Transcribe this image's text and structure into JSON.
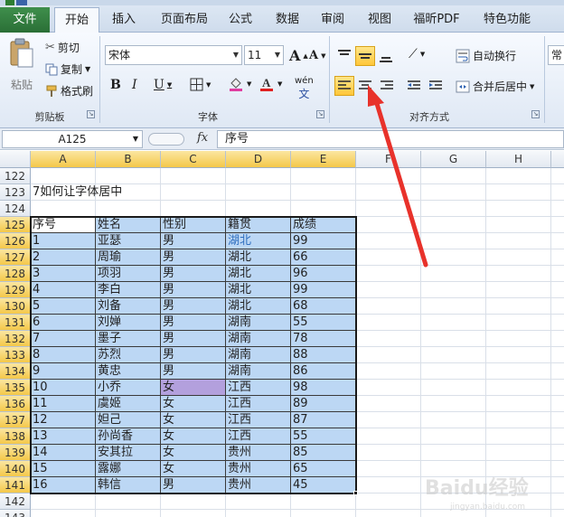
{
  "ribbon_tabs": [
    "文件",
    "开始",
    "插入",
    "页面布局",
    "公式",
    "数据",
    "审阅",
    "视图",
    "福昕PDF",
    "特色功能"
  ],
  "active_tab": "开始",
  "clipboard": {
    "paste": "粘贴",
    "cut": "剪切",
    "copy": "复制",
    "format_painter": "格式刷",
    "group_label": "剪贴板"
  },
  "font": {
    "name": "宋体",
    "size": "11",
    "group_label": "字体",
    "bold": "B",
    "italic": "I",
    "underline": "U",
    "grow": "A",
    "shrink": "A",
    "phonetic": "wén"
  },
  "alignment": {
    "wrap_text": "自动换行",
    "merge_center": "合并后居中",
    "group_label": "对齐方式"
  },
  "number": {
    "format": "常"
  },
  "formula_bar": {
    "name_box": "A125",
    "fx": "fx",
    "content": "序号"
  },
  "columns": [
    "A",
    "B",
    "C",
    "D",
    "E",
    "F",
    "G",
    "H"
  ],
  "rows": [
    {
      "num": "122",
      "cells": [
        "",
        "",
        "",
        "",
        ""
      ]
    },
    {
      "num": "123",
      "cells": [
        "7如何让字体居中",
        "",
        "",
        "",
        ""
      ]
    },
    {
      "num": "124",
      "cells": [
        "",
        "",
        "",
        "",
        ""
      ]
    },
    {
      "num": "125",
      "cells": [
        "序号",
        "姓名",
        "性别",
        "籍贯",
        "成绩"
      ]
    },
    {
      "num": "126",
      "cells": [
        "1",
        "亚瑟",
        "男",
        "湖北",
        "99"
      ]
    },
    {
      "num": "127",
      "cells": [
        "2",
        "周瑜",
        "男",
        "湖北",
        "66"
      ]
    },
    {
      "num": "128",
      "cells": [
        "3",
        "项羽",
        "男",
        "湖北",
        "96"
      ]
    },
    {
      "num": "129",
      "cells": [
        "4",
        "李白",
        "男",
        "湖北",
        "99"
      ]
    },
    {
      "num": "130",
      "cells": [
        "5",
        "刘备",
        "男",
        "湖北",
        "68"
      ]
    },
    {
      "num": "131",
      "cells": [
        "6",
        "刘婵",
        "男",
        "湖南",
        "55"
      ]
    },
    {
      "num": "132",
      "cells": [
        "7",
        "墨子",
        "男",
        "湖南",
        "78"
      ]
    },
    {
      "num": "133",
      "cells": [
        "8",
        "苏烈",
        "男",
        "湖南",
        "88"
      ]
    },
    {
      "num": "134",
      "cells": [
        "9",
        "黄忠",
        "男",
        "湖南",
        "86"
      ]
    },
    {
      "num": "135",
      "cells": [
        "10",
        "小乔",
        "女",
        "江西",
        "98"
      ]
    },
    {
      "num": "136",
      "cells": [
        "11",
        "虞姬",
        "女",
        "江西",
        "89"
      ]
    },
    {
      "num": "137",
      "cells": [
        "12",
        "妲己",
        "女",
        "江西",
        "87"
      ]
    },
    {
      "num": "138",
      "cells": [
        "13",
        "孙尚香",
        "女",
        "江西",
        "55"
      ]
    },
    {
      "num": "139",
      "cells": [
        "14",
        "安其拉",
        "女",
        "贵州",
        "85"
      ]
    },
    {
      "num": "140",
      "cells": [
        "15",
        "露娜",
        "女",
        "贵州",
        "65"
      ]
    },
    {
      "num": "141",
      "cells": [
        "16",
        "韩信",
        "男",
        "贵州",
        "45"
      ]
    },
    {
      "num": "142",
      "cells": [
        "",
        "",
        "",
        "",
        ""
      ]
    },
    {
      "num": "143",
      "cells": [
        "",
        "",
        "",
        "",
        ""
      ]
    }
  ],
  "colors": {
    "selection_fill": "#bcd7f4",
    "highlight_cell": "#b3a0dd",
    "accent_tab": "#2a6f36",
    "arrow": "#e8322b"
  },
  "watermark": {
    "logo": "Baidu经验",
    "url": "jingyan.baidu.com"
  }
}
